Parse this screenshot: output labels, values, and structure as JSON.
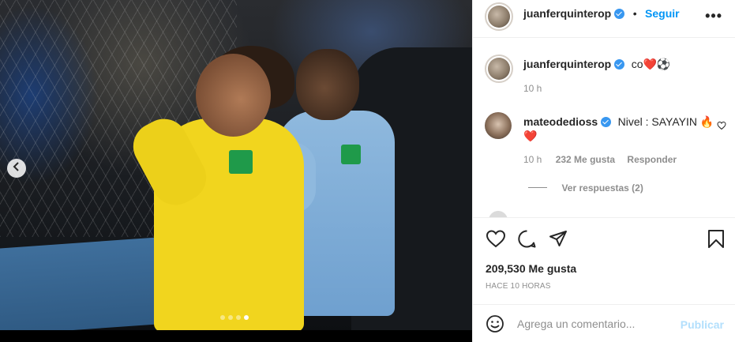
{
  "post": {
    "author": "juanferquinterop",
    "follow_label": "Seguir",
    "separator": "•",
    "more_label": "•••",
    "photo_alt": "",
    "carousel": {
      "count": 4,
      "active_index": 3
    }
  },
  "caption": {
    "author": "juanferquinterop",
    "text": "co",
    "emoji": "❤️⚽",
    "time": "10 h"
  },
  "comments": [
    {
      "author": "mateodedioss",
      "text": "Nivel : SAYAYIN 🔥",
      "emoji_line": "❤️",
      "time": "10 h",
      "likes": "232 Me gusta",
      "reply_label": "Responder",
      "view_replies": "Ver respuestas (2)"
    }
  ],
  "stats": {
    "likes": "209,530 Me gusta",
    "posted": "HACE 10 HORAS"
  },
  "composer": {
    "placeholder": "Agrega un comentario...",
    "publish_label": "Publicar"
  },
  "colors": {
    "accent": "#0095f6",
    "publish_disabled": "#b2dffc",
    "verified": "#3897f0",
    "heart": "#ed4956"
  }
}
